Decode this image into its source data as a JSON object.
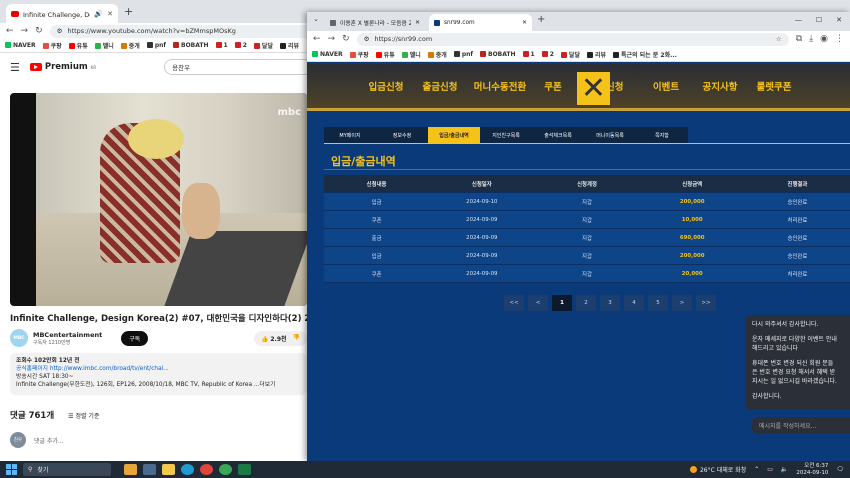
{
  "left_browser": {
    "tab_title": "Infinite Challenge, Design Korea(2) #07, 대한민국을 디자인하다(2) 20081018",
    "url": "https://www.youtube.com/watch?v=bZMmspMOsKg",
    "bookmarks": [
      "NAVER",
      "쿠팡",
      "유튜",
      "멜니",
      "중개",
      "pnf",
      "BOBATH",
      "1",
      "2",
      "달달",
      "리뷰"
    ],
    "brand": "Premium",
    "brand_sup": "KR",
    "search_value": "용찬우",
    "video_watermark": "mbc",
    "video_title": "Infinite Challenge, Design Korea(2) #07, 대한민국을 디자인하다(2) 20081018",
    "channel_avatar_text": "MBC",
    "channel_name": "MBCentertainment",
    "channel_subs": "구독자 1210만명",
    "subscribe_label": "구독",
    "like_count": "2.9천",
    "description": [
      "조회수 102만회  12년 전",
      "공식홈페이지  http://www.imbc.com/broad/tv/ent/chal...",
      "방송시간  SAT 18:30~",
      "Infinite Challenge(무한도전), 126회, EP126, 2008/10/18, MBC TV, Republic of Korea ...더보기"
    ],
    "comments_count": "댓글 761개",
    "sort_label": "정렬 기준",
    "comment_avatar": "친우",
    "comment_placeholder": "댓글 추가..."
  },
  "right_browser": {
    "tabs": [
      {
        "title": "이용혼 X 별론나라 - 모음큼 2024..."
      },
      {
        "title": "snr99.com"
      }
    ],
    "url": "https://snr99.com",
    "bookmarks": [
      "NAVER",
      "쿠팡",
      "유튜",
      "멜니",
      "중개",
      "pnf",
      "BOBATH",
      "1",
      "2",
      "달달",
      "리뷰",
      "특근의 되는 분 2화..."
    ],
    "nav": [
      "입금신청",
      "출금신청",
      "머니수동전환",
      "쿠폰",
      "콤프신청",
      "이벤트",
      "공지사항",
      "룰렛쿠폰"
    ],
    "subtabs": [
      "MY페이지",
      "정보수정",
      "입금/출금내역",
      "지인친구목록",
      "출석체크목록",
      "머니이동목록",
      "쪽지함"
    ],
    "active_subtab": 2,
    "page_title": "입금/출금내역",
    "table_headers": [
      "신청내용",
      "신청일자",
      "신청계정",
      "신청금액",
      "진행결과"
    ],
    "table_rows": [
      [
        "입금",
        "2024-09-10",
        "지갑",
        "200,000",
        "승인완료"
      ],
      [
        "쿠폰",
        "2024-09-09",
        "지갑",
        "10,000",
        "처리완료"
      ],
      [
        "출금",
        "2024-09-09",
        "지갑",
        "690,000",
        "승인완료"
      ],
      [
        "입금",
        "2024-09-09",
        "지갑",
        "200,000",
        "승인완료"
      ],
      [
        "쿠폰",
        "2024-09-09",
        "지갑",
        "20,000",
        "처리완료"
      ]
    ],
    "pagination": [
      "<<",
      "<",
      "1",
      "2",
      "3",
      "4",
      "5",
      ">",
      ">>"
    ],
    "current_page": "1",
    "chat_lines": [
      "다시 와주셔서 감사합니다.",
      "운자 메세지로 다양한 이벤트 안내",
      "해드리고 있습니다",
      "휴대폰 번호 변경 되신 회원 분들",
      "은 번호 변경 요청 해서서 혜택 받",
      "지시는 일 없으시길 바라겠습니다.",
      "감사합니다."
    ],
    "chat_placeholder": "메시지를 작성하세요..."
  },
  "taskbar": {
    "search_label": "찾기",
    "weather": "26°C  대체로 화창",
    "time": "오전 6:37",
    "date": "2024-09-10"
  },
  "colors": {
    "site_gold": "#f5c21a",
    "site_blue": "#0a3a79",
    "youtube_red": "#ff0000"
  }
}
